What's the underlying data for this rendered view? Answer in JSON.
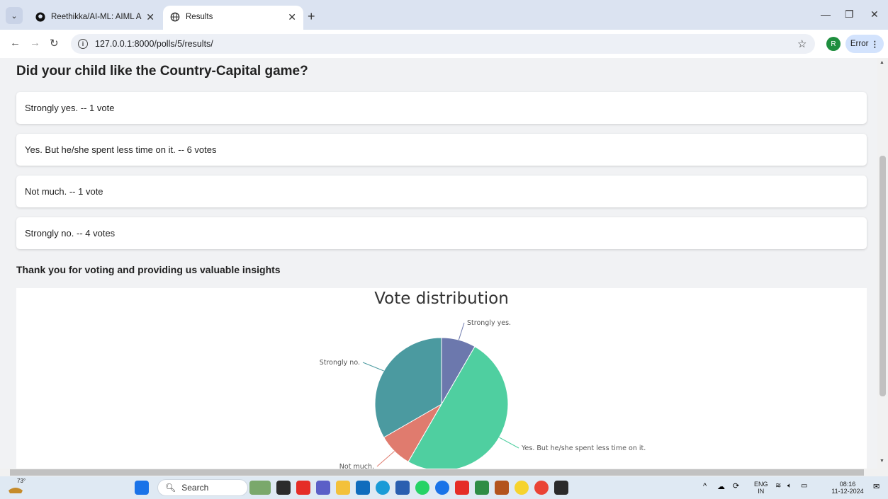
{
  "browser": {
    "tabs": [
      {
        "title": "Reethikka/AI-ML: AIML Assignm",
        "active": false
      },
      {
        "title": "Results",
        "active": true
      }
    ],
    "url": "127.0.0.1:8000/polls/5/results/",
    "profile_initial": "R",
    "error_label": "Error"
  },
  "page": {
    "question": "Did your child like the Country-Capital game?",
    "choices": [
      {
        "text": "Strongly yes. -- 1 vote"
      },
      {
        "text": "Yes. But he/she spent less time on it. -- 6 votes"
      },
      {
        "text": "Not much. -- 1 vote"
      },
      {
        "text": "Strongly no. -- 4 votes"
      }
    ],
    "thanks": "Thank you for voting and providing us valuable insights"
  },
  "chart_data": {
    "type": "pie",
    "title": "Vote distribution",
    "categories": [
      "Strongly yes.",
      "Yes. But he/she spent less time on it.",
      "Not much.",
      "Strongly no."
    ],
    "values": [
      1,
      6,
      1,
      4
    ],
    "colors": [
      "#6c78ad",
      "#4fcfa0",
      "#e07b6e",
      "#4b9aa0"
    ]
  },
  "taskbar": {
    "weather": "73°",
    "search_label": "Search",
    "lang_top": "ENG",
    "lang_bottom": "IN",
    "time": "08:16",
    "date": "11-12-2024"
  }
}
